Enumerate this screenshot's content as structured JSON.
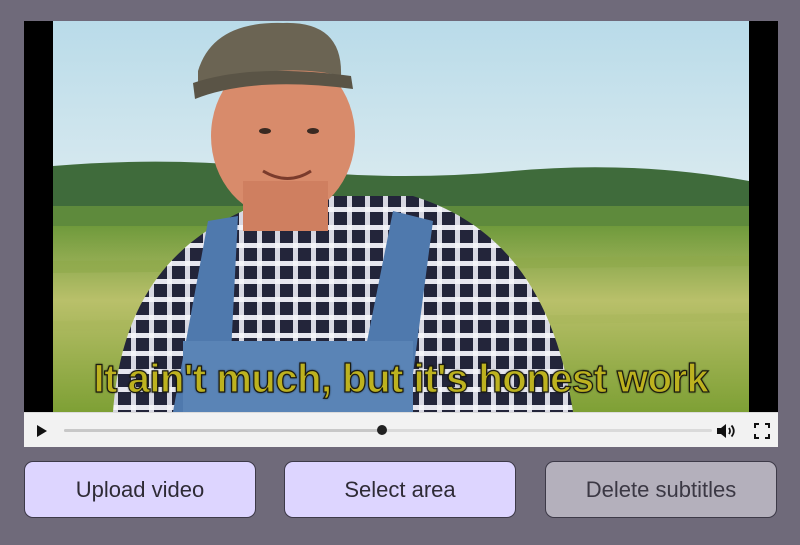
{
  "player": {
    "subtitle_text": "It ain't much, but it's honest work",
    "progress_fraction": 0.49,
    "subtitle_color": "#bdb21f"
  },
  "icons": {
    "play": "play-icon",
    "volume": "volume-icon",
    "fullscreen": "fullscreen-icon"
  },
  "buttons": {
    "upload_label": "Upload video",
    "select_label": "Select area",
    "delete_label": "Delete subtitles"
  },
  "colors": {
    "background": "#6f6a7a",
    "primary_button": "#ddd5ff",
    "disabled_button": "#b4b0bc"
  }
}
